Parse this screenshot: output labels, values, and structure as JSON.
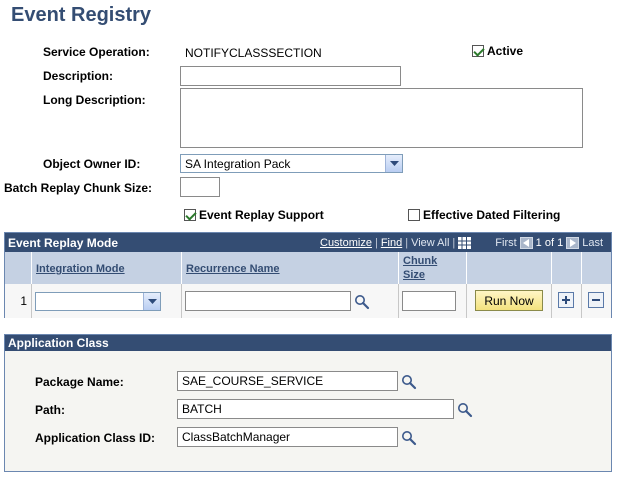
{
  "page": {
    "title": "Event Registry"
  },
  "form": {
    "service_operation_label": "Service Operation:",
    "service_operation_value": "NOTIFYCLASSSECTION",
    "active_label": "Active",
    "active_checked": true,
    "description_label": "Description:",
    "description_value": "",
    "long_description_label": "Long Description:",
    "long_description_value": "",
    "object_owner_label": "Object Owner ID:",
    "object_owner_value": "SA Integration Pack",
    "batch_replay_label": "Batch Replay Chunk Size:",
    "batch_replay_value": "",
    "event_replay_support_label": "Event Replay Support",
    "event_replay_support_checked": true,
    "effective_dated_label": "Effective Dated Filtering",
    "effective_dated_checked": false
  },
  "grid": {
    "title": "Event Replay Mode",
    "customize": "Customize",
    "find": "Find",
    "view_all": "View All",
    "sep": "|",
    "first": "First",
    "range": "1 of 1",
    "last": "Last",
    "columns": [
      "Integration Mode",
      "Recurrence Name",
      "Chunk",
      "Size"
    ],
    "rows": [
      {
        "num": "1",
        "integration_mode": "",
        "recurrence_name": "",
        "chunk_size": "",
        "run_label": "Run Now"
      }
    ]
  },
  "app_class": {
    "title": "Application Class",
    "package_label": "Package Name:",
    "package_value": "SAE_COURSE_SERVICE",
    "path_label": "Path:",
    "path_value": "BATCH",
    "class_id_label": "Application Class ID:",
    "class_id_value": "ClassBatchManager"
  },
  "colors": {
    "title": "#344d73",
    "header_bg": "#344d73",
    "column_header_bg": "#c5d1e3",
    "run_button_bg": "#f3e27e"
  }
}
